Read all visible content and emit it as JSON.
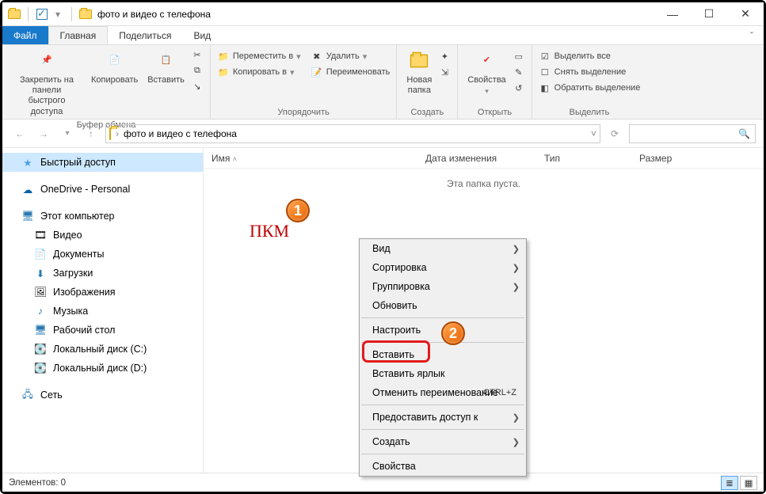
{
  "window": {
    "title": "фото и видео с телефона"
  },
  "menu": {
    "file": "Файл",
    "tabs": [
      "Главная",
      "Поделиться",
      "Вид"
    ],
    "active": 0
  },
  "ribbon": {
    "clipboard": {
      "pin": "Закрепить на панели\nбыстрого доступа",
      "copy": "Копировать",
      "paste": "Вставить",
      "label": "Буфер обмена"
    },
    "organize": {
      "moveTo": "Переместить в",
      "copyTo": "Копировать в",
      "delete": "Удалить",
      "rename": "Переименовать",
      "label": "Упорядочить"
    },
    "new": {
      "newFolder": "Новая\nпапка",
      "label": "Создать"
    },
    "open": {
      "properties": "Свойства",
      "label": "Открыть"
    },
    "select": {
      "selectAll": "Выделить все",
      "selectNone": "Снять выделение",
      "invert": "Обратить выделение",
      "label": "Выделить"
    }
  },
  "address": {
    "path": "фото и видео с телефона"
  },
  "nav": {
    "quickAccess": "Быстрый доступ",
    "onedrive": "OneDrive - Personal",
    "thisPC": "Этот компьютер",
    "videos": "Видео",
    "documents": "Документы",
    "downloads": "Загрузки",
    "pictures": "Изображения",
    "music": "Музыка",
    "desktop": "Рабочий стол",
    "diskC": "Локальный диск (C:)",
    "diskD": "Локальный диск (D:)",
    "network": "Сеть"
  },
  "columns": {
    "name": "Имя",
    "date": "Дата изменения",
    "type": "Тип",
    "size": "Размер"
  },
  "content": {
    "empty": "Эта папка пуста."
  },
  "status": {
    "items": "Элементов: 0"
  },
  "annotations": {
    "rmb": "ПКМ",
    "badge1": "1",
    "badge2": "2"
  },
  "context": {
    "view": "Вид",
    "sort": "Сортировка",
    "group": "Группировка",
    "refresh": "Обновить",
    "customize": "Настроить",
    "paste": "Вставить",
    "pasteShortcut": "Вставить ярлык",
    "undoRename": "Отменить переименование",
    "undoShortcut": "CTRL+Z",
    "shareAccess": "Предоставить доступ к",
    "new": "Создать",
    "properties": "Свойства"
  }
}
